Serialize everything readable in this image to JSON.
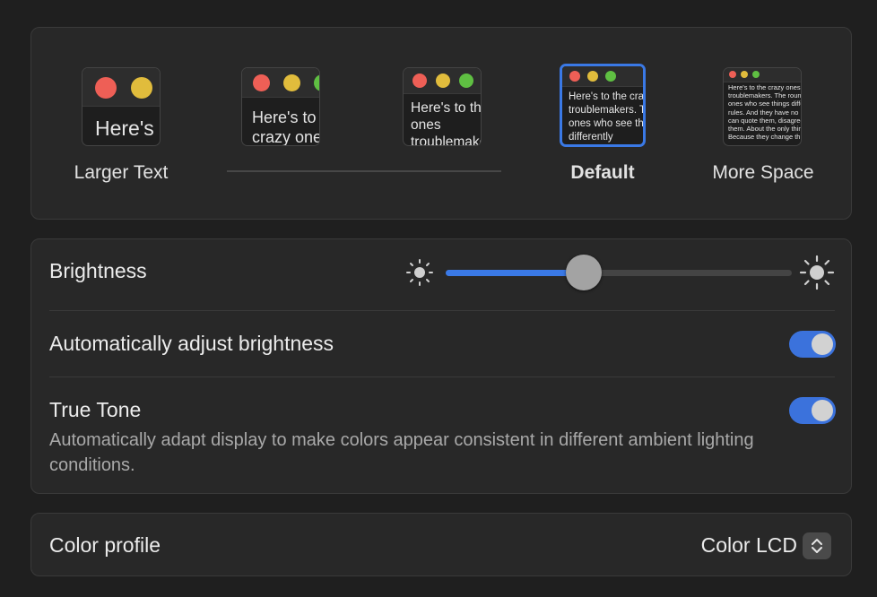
{
  "resolution": {
    "options": [
      {
        "label": "Larger Text",
        "sample": "Here's",
        "selected": false
      },
      {
        "label": "",
        "sample": "Here's to the crazy ones\ntroublemakers\nones who",
        "selected": false
      },
      {
        "label": "",
        "sample": "Here's to the crazy ones\ntroublemakers. The round\nones who see things",
        "selected": false
      },
      {
        "label": "Default",
        "sample": "Here's to the crazy ones\ntroublemakers. The round\nones who see things differently\nrules. And they have no",
        "selected": true
      },
      {
        "label": "More Space",
        "sample": "Here's to the crazy ones. The misfits.\ntroublemakers. The round pegs in the\nones who see things differently. They're\nrules. And they have no respect for the\ncan quote them, disagree with them,\nthem. About the only thing you can't\nBecause they change things.",
        "selected": false
      }
    ]
  },
  "brightness": {
    "label": "Brightness",
    "level": 0.4,
    "auto_adjust_label": "Automatically adjust brightness",
    "auto_adjust_on": true,
    "true_tone_label": "True Tone",
    "true_tone_desc": "Automatically adapt display to make colors appear consistent in different ambient lighting conditions.",
    "true_tone_on": true
  },
  "color_profile": {
    "label": "Color profile",
    "value": "Color LCD"
  },
  "icons": {
    "brightness_low": "sun-small-icon",
    "brightness_high": "sun-large-icon",
    "stepper": "chevron-up-down-icon"
  },
  "colors": {
    "accent": "#3a79e6",
    "panel_bg": "#282828",
    "window_bg": "#1f1f1f"
  }
}
